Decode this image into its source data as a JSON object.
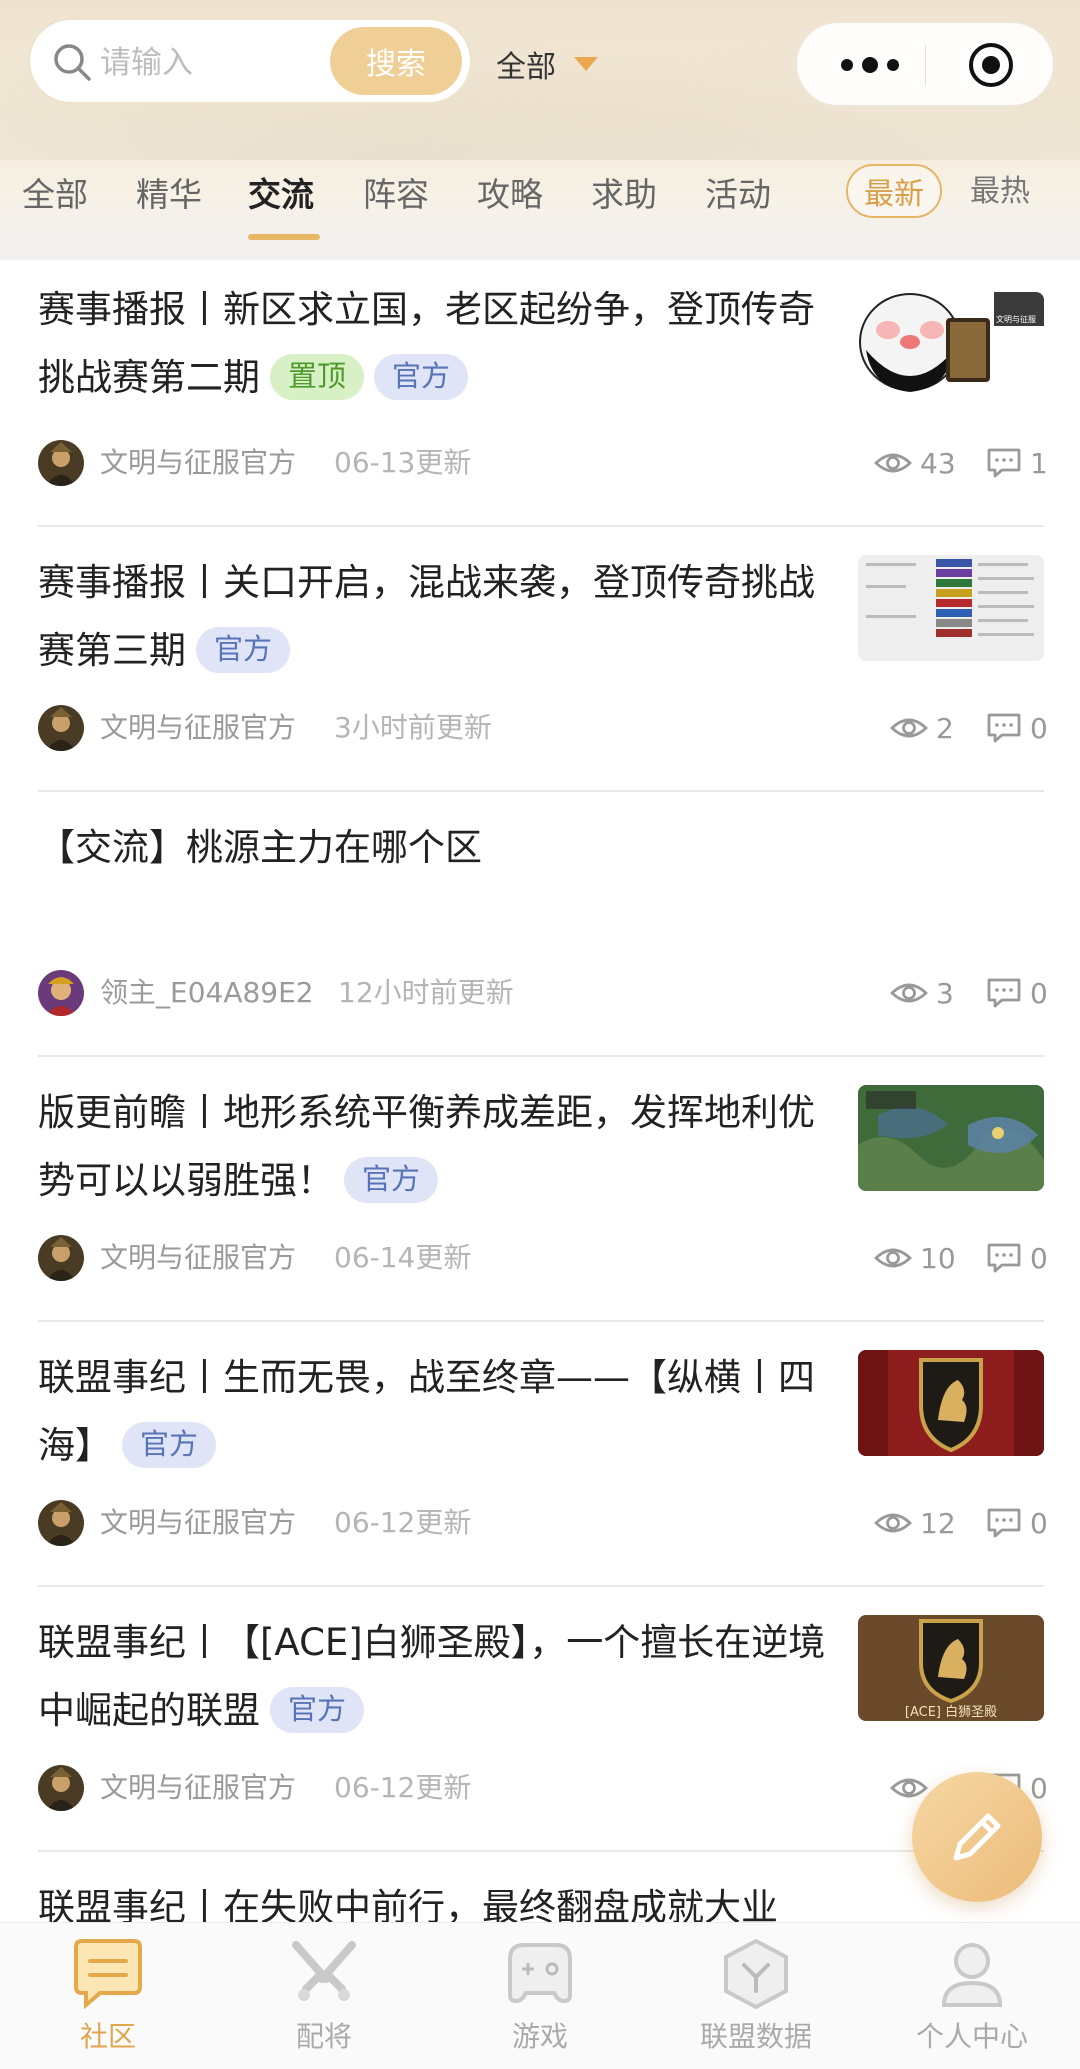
{
  "search": {
    "placeholder": "请输入",
    "button_label": "搜索"
  },
  "scope": {
    "selected": "全部"
  },
  "tabs": [
    {
      "label": "全部"
    },
    {
      "label": "精华"
    },
    {
      "label": "交流"
    },
    {
      "label": "阵容"
    },
    {
      "label": "攻略"
    },
    {
      "label": "求助"
    },
    {
      "label": "活动"
    }
  ],
  "active_tab": "交流",
  "sort": {
    "latest": "最新",
    "hot": "最热",
    "active": "最新"
  },
  "posts": [
    {
      "title": "赛事播报丨新区求立国，老区起纷争，登顶传奇挑战赛第二期",
      "tags": [
        "置顶",
        "官方"
      ],
      "author": "文明与征服官方",
      "time": "06-13更新",
      "views": "43",
      "comments": "1",
      "thumb": "meme"
    },
    {
      "title": "赛事播报丨关口开启，混战来袭，登顶传奇挑战赛第三期",
      "tags": [
        "官方"
      ],
      "author": "文明与征服官方",
      "time": "3小时前更新",
      "views": "2",
      "comments": "0",
      "thumb": "table"
    },
    {
      "title": "【交流】桃源主力在哪个区",
      "tags": [],
      "author": "领主_E04A89E2",
      "time": "12小时前更新",
      "views": "3",
      "comments": "0",
      "thumb": ""
    },
    {
      "title": "版更前瞻丨地形系统平衡养成差距，发挥地利优势可以以弱胜强！",
      "tags": [
        "官方"
      ],
      "author": "文明与征服官方",
      "time": "06-14更新",
      "views": "10",
      "comments": "0",
      "thumb": "map"
    },
    {
      "title": "联盟事纪丨生而无畏，战至终章——【纵横丨四海】",
      "tags": [
        "官方"
      ],
      "author": "文明与征服官方",
      "time": "06-12更新",
      "views": "12",
      "comments": "0",
      "thumb": "shield-red"
    },
    {
      "title": "联盟事纪丨【[ACE]白狮圣殿】，一个擅长在逆境中崛起的联盟",
      "tags": [
        "官方"
      ],
      "author": "文明与征服官方",
      "time": "06-12更新",
      "views": "",
      "comments": "0",
      "thumb": "shield-brown",
      "thumb_caption": "[ACE] 白狮圣殿"
    },
    {
      "title": "联盟事纪丨在失败中前行，最终翻盘成就大业",
      "tags": [],
      "author": "",
      "time": "",
      "views": "",
      "comments": "",
      "thumb": ""
    }
  ],
  "meme_caption": "文明与征服",
  "tabbar": [
    {
      "label": "社区",
      "icon": "chat-icon"
    },
    {
      "label": "配将",
      "icon": "crossed-swords-icon"
    },
    {
      "label": "游戏",
      "icon": "gamepad-icon"
    },
    {
      "label": "联盟数据",
      "icon": "hexagon-icon"
    },
    {
      "label": "个人中心",
      "icon": "person-icon"
    }
  ],
  "active_tabbar": "社区",
  "colors": {
    "accent": "#e8b764",
    "tag_official": "#5873b8",
    "tag_pin": "#4e9a2a"
  }
}
